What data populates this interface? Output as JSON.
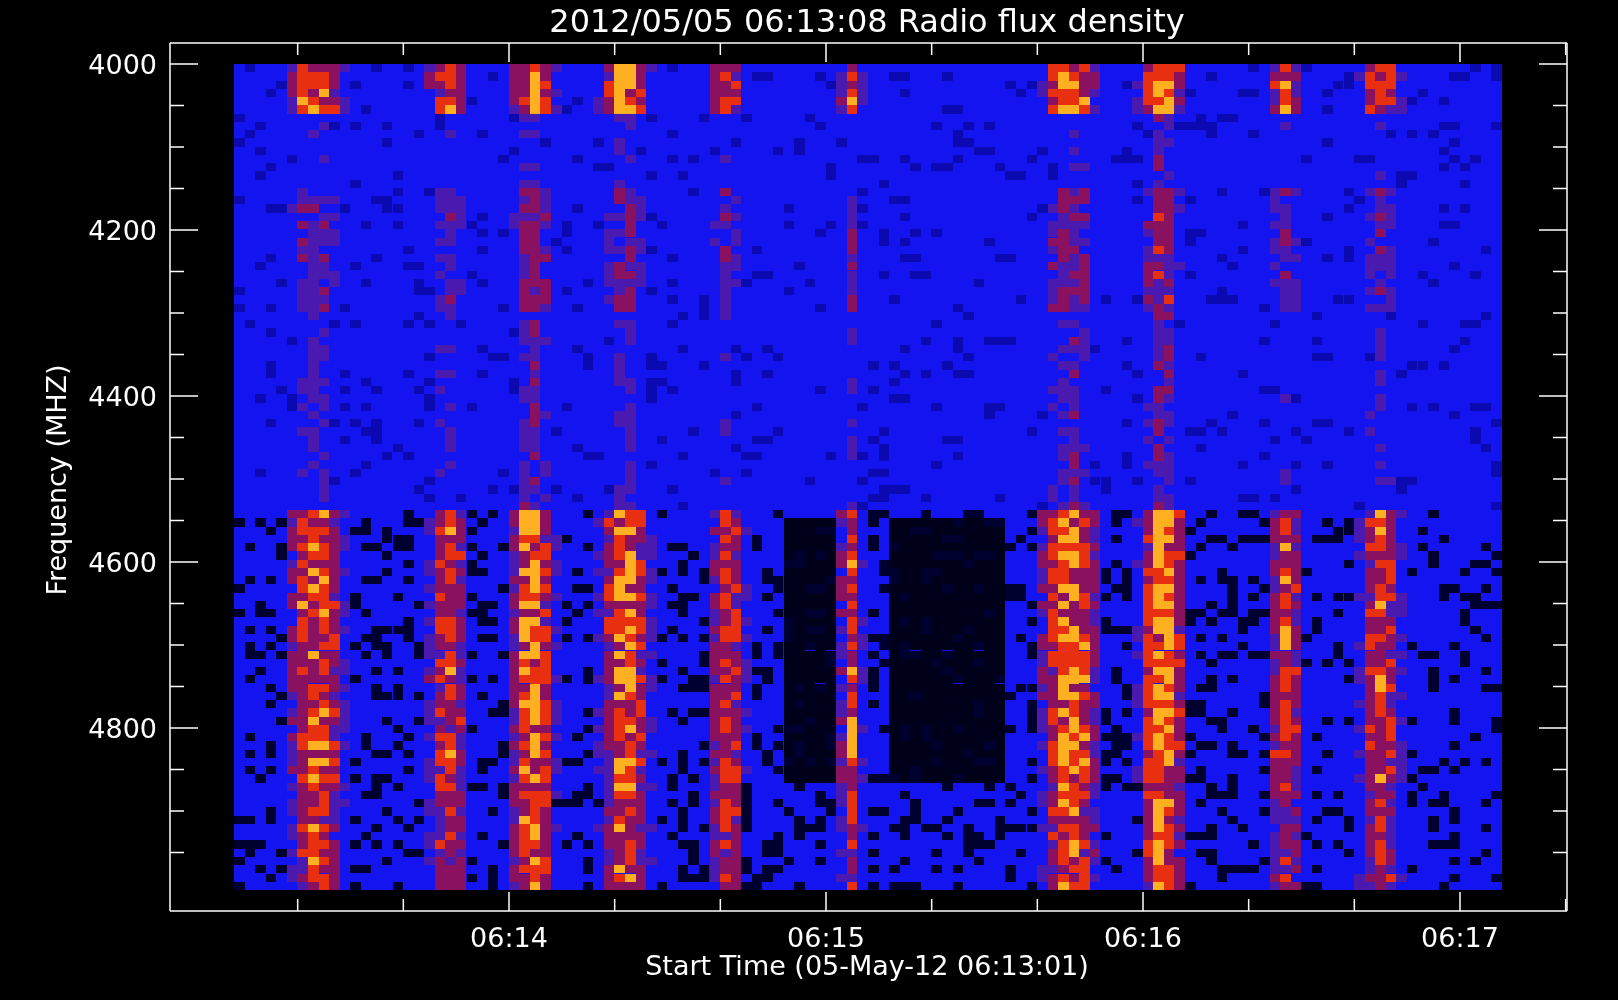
{
  "plot": {
    "title": "2012/05/05 06:13:08 Radio flux density",
    "xlabel": "Start Time (05-May-12 06:13:01)",
    "ylabel": "Frequency (MHZ)",
    "x_tick_labels": [
      "06:14",
      "06:15",
      "06:16",
      "06:17"
    ],
    "y_tick_labels": [
      "4000",
      "4200",
      "4400",
      "4600",
      "4800"
    ]
  }
}
